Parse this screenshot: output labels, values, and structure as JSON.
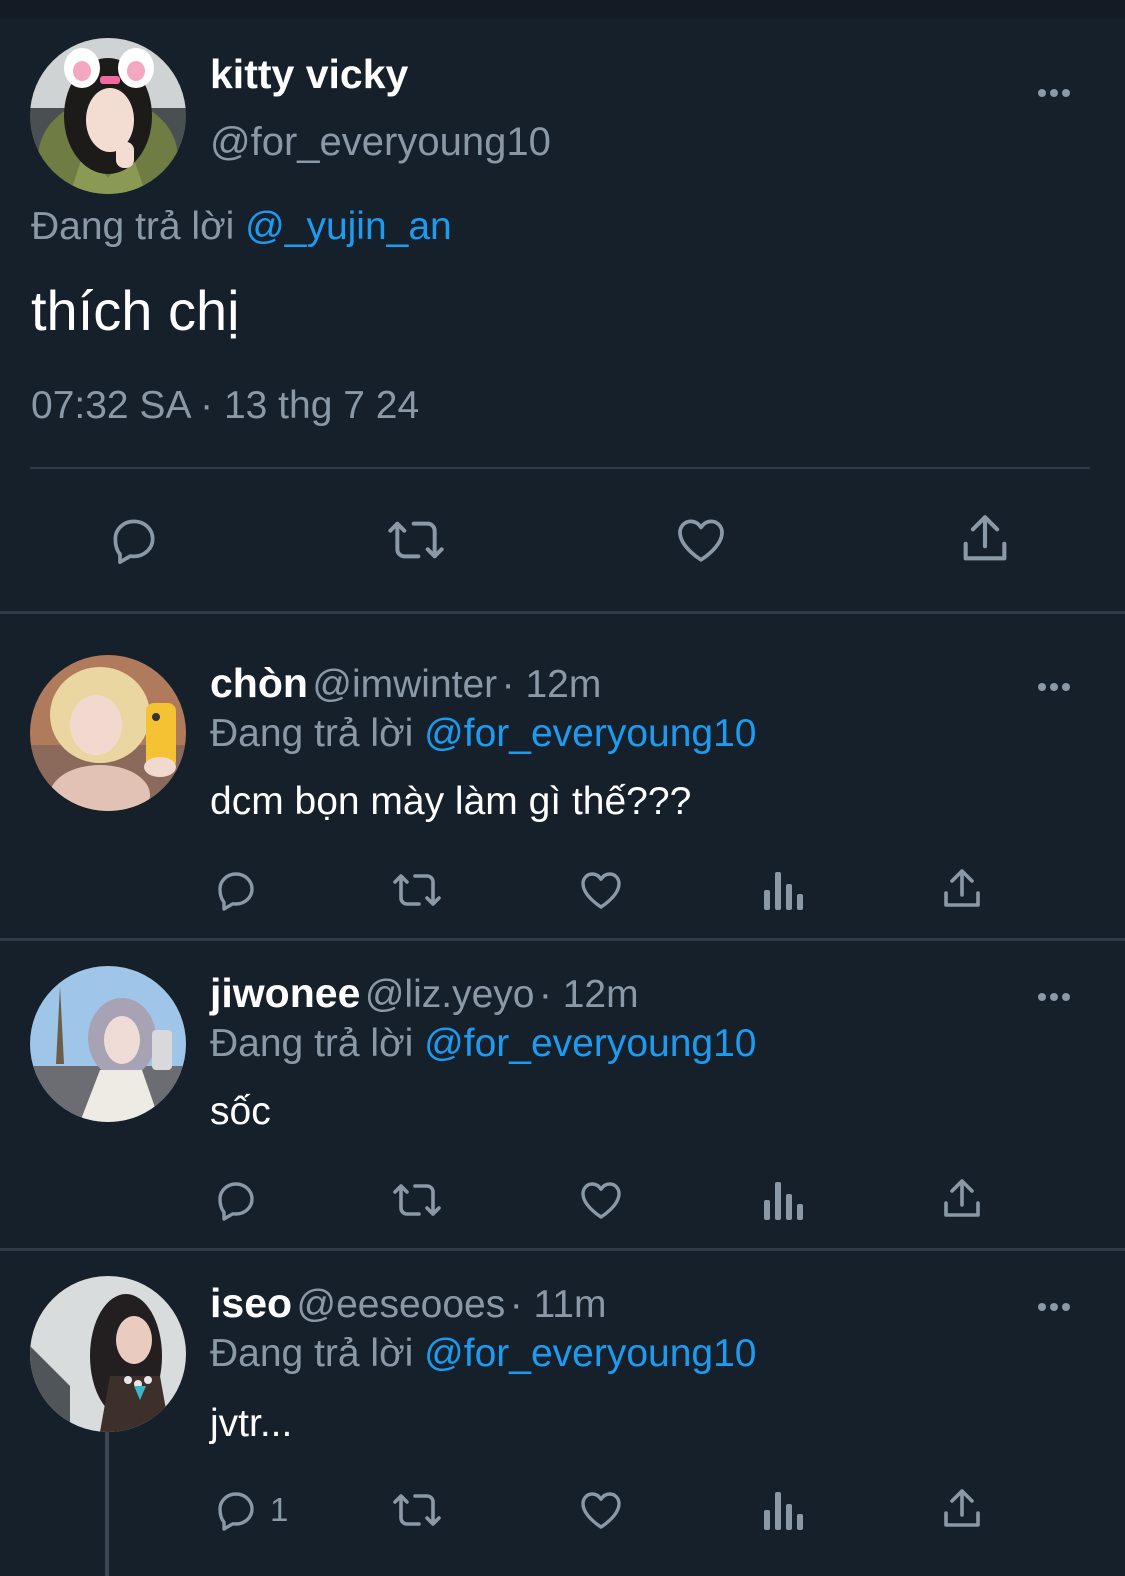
{
  "main_tweet": {
    "name": "kitty vicky",
    "handle": "@for_everyoung10",
    "reply_prefix": "Đang trả lời",
    "reply_to": "@_yujin_an",
    "text": "thích chị",
    "timestamp": "07:32 SA · 13 thg 7 24"
  },
  "replies": [
    {
      "name": "chòn",
      "handle": "@imwinter",
      "time": "· 12m",
      "reply_prefix": "Đang trả lời",
      "reply_to": "@for_everyoung10",
      "text": "dcm bọn mày làm gì thế???",
      "reply_count": ""
    },
    {
      "name": "jiwonee",
      "handle": "@liz.yeyo",
      "time": "· 12m",
      "reply_prefix": "Đang trả lời",
      "reply_to": "@for_everyoung10",
      "text": "sốc",
      "reply_count": ""
    },
    {
      "name": "iseo",
      "handle": "@eeseooes",
      "time": "· 11m",
      "reply_prefix": "Đang trả lời",
      "reply_to": "@for_everyoung10",
      "text": "jvtr...",
      "reply_count": "1"
    }
  ],
  "icons": {
    "reply": "reply-icon",
    "retweet": "retweet-icon",
    "like": "heart-icon",
    "views": "views-icon",
    "share": "share-icon",
    "more": "more-icon"
  },
  "colors": {
    "background": "#15202b",
    "text": "#ffffff",
    "muted": "#8b98a5",
    "link": "#1d9bf0",
    "divider": "#2f3b47"
  }
}
